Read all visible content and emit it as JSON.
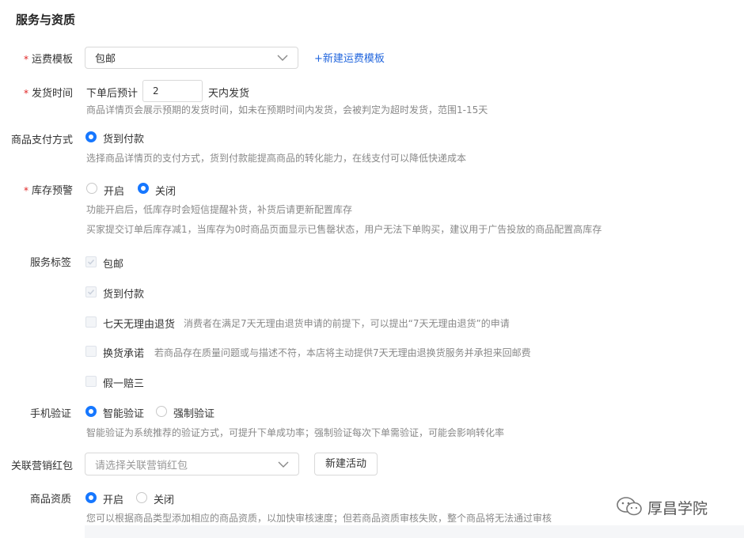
{
  "section": {
    "title": "服务与资质"
  },
  "shipping_template": {
    "label": "运费模板",
    "required_mark": "*",
    "selected": "包邮",
    "new_link": "新建运费模板",
    "new_link_plus": "+"
  },
  "delivery_time": {
    "label": "发货时间",
    "required_mark": "*",
    "prefix": "下单后预计",
    "value": "2",
    "suffix": "天内发货",
    "help": "商品详情页会展示预期的发货时间，如未在预期时间内发货，会被判定为超时发货，范围1-15天"
  },
  "payment": {
    "label": "商品支付方式",
    "option": "货到付款",
    "selected": true,
    "help": "选择商品详情页的支付方式，货到付款能提高商品的转化能力，在线支付可以降低快递成本"
  },
  "stock_alert": {
    "label": "库存预警",
    "required_mark": "*",
    "options": [
      "开启",
      "关闭"
    ],
    "selected": "关闭",
    "help1": "功能开启后，低库存时会短信提醒补货，补货后请更新配置库存",
    "help2": "买家提交订单后库存减1，当库存为0时商品页面显示已售罄状态，用户无法下单购买，建议用于广告投放的商品配置高库存"
  },
  "service_tags": {
    "label": "服务标签",
    "items": [
      {
        "label": "包邮",
        "checked": true,
        "desc": ""
      },
      {
        "label": "货到付款",
        "checked": true,
        "desc": ""
      },
      {
        "label": "七天无理由退货",
        "checked": false,
        "desc": "消费者在满足7天无理由退货申请的前提下，可以提出“7天无理由退货”的申请"
      },
      {
        "label": "换货承诺",
        "checked": false,
        "desc": "若商品存在质量问题或与描述不符，本店将主动提供7天无理由退换货服务并承担来回邮费"
      },
      {
        "label": "假一赔三",
        "checked": false,
        "desc": ""
      }
    ]
  },
  "phone_verify": {
    "label": "手机验证",
    "options": [
      "智能验证",
      "强制验证"
    ],
    "selected": "智能验证",
    "help": "智能验证为系统推荐的验证方式，可提升下单成功率；强制验证每次下单需验证，可能会影响转化率"
  },
  "red_packet": {
    "label": "关联营销红包",
    "placeholder": "请选择关联营销红包",
    "button": "新建活动"
  },
  "qualification": {
    "label": "商品资质",
    "options": [
      "开启",
      "关闭"
    ],
    "selected": "开启",
    "help": "您可以根据商品类型添加相应的商品资质，以加快审核速度；但若商品资质审核失败，整个商品将无法通过审核"
  },
  "watermark": {
    "text": "厚昌学院",
    "icon": "wechat-icon"
  },
  "colors": {
    "accent": "#1677ff",
    "required": "#e02424",
    "link": "#2266dd"
  }
}
